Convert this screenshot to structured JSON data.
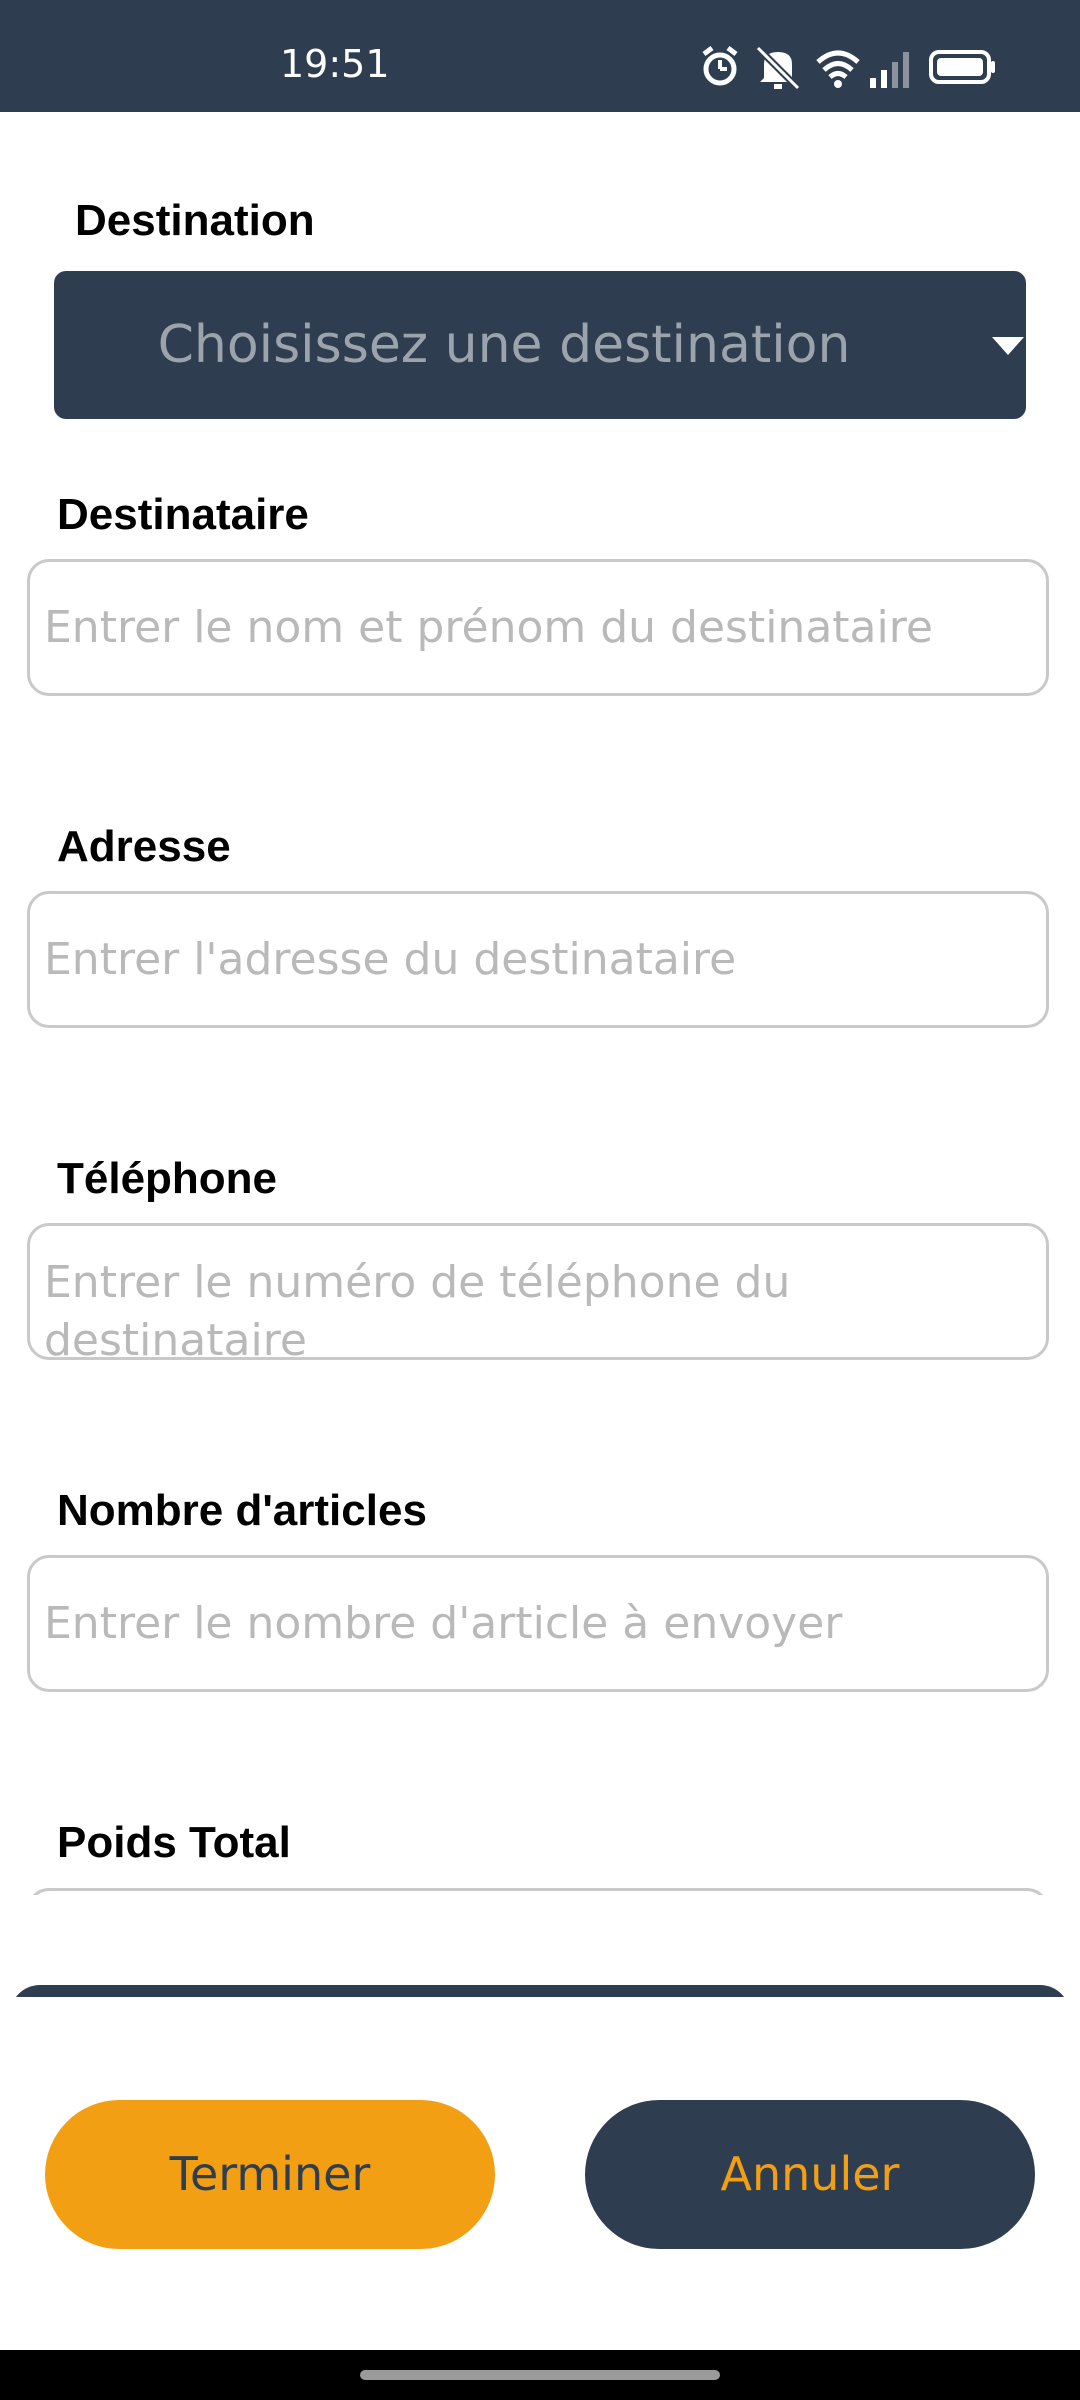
{
  "status_bar": {
    "time": "19:51",
    "icons": [
      "alarm-icon",
      "mute-icon",
      "wifi-icon",
      "signal-icon",
      "battery-icon"
    ]
  },
  "form": {
    "destination": {
      "label": "Destination",
      "dropdown_value": "Choisissez une destination"
    },
    "recipient": {
      "label": "Destinataire",
      "placeholder": "Entrer le nom et prénom du destinataire"
    },
    "address": {
      "label": "Adresse",
      "placeholder": "Entrer l'adresse du destinataire"
    },
    "phone": {
      "label": "Téléphone",
      "placeholder": "Entrer le numéro de téléphone du destinataire"
    },
    "item_count": {
      "label": "Nombre d'articles",
      "placeholder": "Entrer le nombre d'article à envoyer"
    },
    "total_weight": {
      "label": "Poids Total"
    }
  },
  "actions": {
    "finish_label": "Terminer",
    "cancel_label": "Annuler"
  },
  "colors": {
    "primary_dark": "#2e3e50",
    "accent_orange": "#f29f14",
    "placeholder_gray": "#b9b9b9",
    "border_gray": "#c9c9c9"
  }
}
